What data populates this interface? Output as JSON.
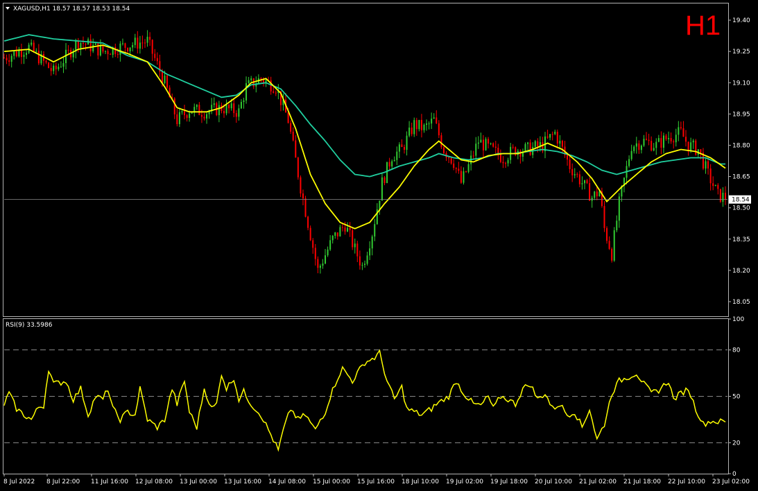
{
  "header": {
    "symbol_line": "XAGUSD,H1  18.57 18.57 18.53 18.54",
    "timeframe": "H1"
  },
  "price_pane": {
    "current_price_label": "18.54",
    "current_price": 18.54
  },
  "rsi_pane": {
    "label": "RSI(9) 33.5986"
  },
  "colors": {
    "background": "#000000",
    "bull": "#32cd32",
    "bear": "#ff0000",
    "fast_ma": "#ffff00",
    "slow_ma": "#20d0a0",
    "rsi": "#ffff00",
    "timeframe_text": "#ff0000"
  },
  "chart_data": [
    {
      "type": "candlestick",
      "symbol": "XAGUSD",
      "timeframe": "H1",
      "ylim": [
        17.98,
        19.48
      ],
      "y_ticks": [
        19.4,
        19.25,
        19.1,
        18.95,
        18.8,
        18.65,
        18.5,
        18.35,
        18.2,
        18.05
      ],
      "x_tick_labels": [
        "8 Jul 2022",
        "8 Jul 22:00",
        "11 Jul 16:00",
        "12 Jul 08:00",
        "13 Jul 00:00",
        "13 Jul 16:00",
        "14 Jul 08:00",
        "15 Jul 00:00",
        "15 Jul 16:00",
        "18 Jul 10:00",
        "19 Jul 02:00",
        "19 Jul 18:00",
        "20 Jul 10:00",
        "21 Jul 02:00",
        "21 Jul 18:00",
        "22 Jul 10:00",
        "23 Jul 02:00"
      ],
      "close_path": [
        [
          0,
          19.22
        ],
        [
          10,
          19.27
        ],
        [
          20,
          19.15
        ],
        [
          30,
          19.3
        ],
        [
          40,
          19.25
        ],
        [
          50,
          19.28
        ],
        [
          58,
          19.3
        ],
        [
          65,
          19.1
        ],
        [
          70,
          18.92
        ],
        [
          75,
          18.97
        ],
        [
          82,
          18.96
        ],
        [
          88,
          18.98
        ],
        [
          95,
          18.96
        ],
        [
          98,
          19.08
        ],
        [
          104,
          19.12
        ],
        [
          110,
          19.08
        ],
        [
          115,
          18.92
        ],
        [
          120,
          18.6
        ],
        [
          127,
          18.2
        ],
        [
          133,
          18.35
        ],
        [
          138,
          18.42
        ],
        [
          142,
          18.3
        ],
        [
          145,
          18.22
        ],
        [
          149,
          18.38
        ],
        [
          153,
          18.62
        ],
        [
          157,
          18.75
        ],
        [
          161,
          18.78
        ],
        [
          166,
          18.9
        ],
        [
          170,
          18.88
        ],
        [
          174,
          18.92
        ],
        [
          178,
          18.78
        ],
        [
          182,
          18.72
        ],
        [
          185,
          18.62
        ],
        [
          188,
          18.7
        ],
        [
          192,
          18.82
        ],
        [
          197,
          18.78
        ],
        [
          202,
          18.74
        ],
        [
          207,
          18.78
        ],
        [
          212,
          18.78
        ],
        [
          218,
          18.8
        ],
        [
          223,
          18.86
        ],
        [
          229,
          18.7
        ],
        [
          234,
          18.62
        ],
        [
          238,
          18.55
        ],
        [
          241,
          18.58
        ],
        [
          243,
          18.4
        ],
        [
          246,
          18.28
        ],
        [
          249,
          18.52
        ],
        [
          254,
          18.8
        ],
        [
          259,
          18.82
        ],
        [
          264,
          18.8
        ],
        [
          269,
          18.84
        ],
        [
          274,
          18.86
        ],
        [
          277,
          18.8
        ],
        [
          281,
          18.78
        ],
        [
          285,
          18.66
        ],
        [
          289,
          18.56
        ],
        [
          292,
          18.55
        ]
      ],
      "fast_ma": [
        [
          0,
          19.25
        ],
        [
          10,
          19.26
        ],
        [
          20,
          19.2
        ],
        [
          30,
          19.26
        ],
        [
          40,
          19.28
        ],
        [
          50,
          19.24
        ],
        [
          58,
          19.2
        ],
        [
          65,
          19.08
        ],
        [
          70,
          18.98
        ],
        [
          75,
          18.96
        ],
        [
          82,
          18.96
        ],
        [
          88,
          18.98
        ],
        [
          95,
          19.04
        ],
        [
          100,
          19.1
        ],
        [
          106,
          19.12
        ],
        [
          112,
          19.05
        ],
        [
          118,
          18.88
        ],
        [
          124,
          18.66
        ],
        [
          130,
          18.52
        ],
        [
          136,
          18.43
        ],
        [
          142,
          18.4
        ],
        [
          148,
          18.43
        ],
        [
          154,
          18.52
        ],
        [
          160,
          18.6
        ],
        [
          166,
          18.7
        ],
        [
          172,
          18.78
        ],
        [
          176,
          18.82
        ],
        [
          180,
          18.78
        ],
        [
          185,
          18.73
        ],
        [
          190,
          18.72
        ],
        [
          196,
          18.75
        ],
        [
          202,
          18.76
        ],
        [
          208,
          18.76
        ],
        [
          214,
          18.78
        ],
        [
          220,
          18.81
        ],
        [
          226,
          18.78
        ],
        [
          232,
          18.72
        ],
        [
          238,
          18.64
        ],
        [
          244,
          18.53
        ],
        [
          250,
          18.6
        ],
        [
          256,
          18.66
        ],
        [
          262,
          18.72
        ],
        [
          268,
          18.76
        ],
        [
          274,
          18.78
        ],
        [
          280,
          18.77
        ],
        [
          286,
          18.74
        ],
        [
          292,
          18.69
        ]
      ],
      "slow_ma": [
        [
          0,
          19.3
        ],
        [
          10,
          19.33
        ],
        [
          20,
          19.31
        ],
        [
          30,
          19.3
        ],
        [
          40,
          19.29
        ],
        [
          50,
          19.23
        ],
        [
          58,
          19.2
        ],
        [
          66,
          19.14
        ],
        [
          74,
          19.1
        ],
        [
          82,
          19.06
        ],
        [
          88,
          19.03
        ],
        [
          94,
          19.04
        ],
        [
          100,
          19.09
        ],
        [
          106,
          19.1
        ],
        [
          112,
          19.07
        ],
        [
          118,
          18.99
        ],
        [
          124,
          18.9
        ],
        [
          130,
          18.82
        ],
        [
          136,
          18.73
        ],
        [
          142,
          18.66
        ],
        [
          148,
          18.65
        ],
        [
          154,
          18.67
        ],
        [
          160,
          18.7
        ],
        [
          166,
          18.72
        ],
        [
          172,
          18.74
        ],
        [
          176,
          18.76
        ],
        [
          182,
          18.74
        ],
        [
          188,
          18.73
        ],
        [
          194,
          18.74
        ],
        [
          200,
          18.76
        ],
        [
          206,
          18.76
        ],
        [
          212,
          18.77
        ],
        [
          218,
          18.78
        ],
        [
          224,
          18.77
        ],
        [
          230,
          18.75
        ],
        [
          236,
          18.72
        ],
        [
          242,
          18.68
        ],
        [
          248,
          18.66
        ],
        [
          254,
          18.68
        ],
        [
          260,
          18.7
        ],
        [
          266,
          18.72
        ],
        [
          272,
          18.73
        ],
        [
          278,
          18.74
        ],
        [
          284,
          18.74
        ],
        [
          290,
          18.71
        ]
      ]
    },
    {
      "type": "line",
      "name": "RSI(9) 33.5986",
      "ylim": [
        0,
        100
      ],
      "y_ticks": [
        100,
        80,
        50,
        20,
        0
      ],
      "levels": [
        80,
        50,
        20
      ],
      "values": [
        [
          0,
          45
        ],
        [
          2,
          52
        ],
        [
          5,
          42
        ],
        [
          8,
          38
        ],
        [
          11,
          35
        ],
        [
          14,
          43
        ],
        [
          16,
          44
        ],
        [
          18,
          68
        ],
        [
          20,
          58
        ],
        [
          23,
          59
        ],
        [
          25,
          60
        ],
        [
          28,
          48
        ],
        [
          31,
          55
        ],
        [
          34,
          38
        ],
        [
          37,
          50
        ],
        [
          40,
          48
        ],
        [
          42,
          55
        ],
        [
          44,
          42
        ],
        [
          47,
          35
        ],
        [
          50,
          40
        ],
        [
          53,
          38
        ],
        [
          55,
          55
        ],
        [
          58,
          35
        ],
        [
          62,
          30
        ],
        [
          65,
          35
        ],
        [
          68,
          55
        ],
        [
          70,
          45
        ],
        [
          73,
          60
        ],
        [
          75,
          40
        ],
        [
          78,
          30
        ],
        [
          81,
          55
        ],
        [
          84,
          42
        ],
        [
          86,
          45
        ],
        [
          88,
          65
        ],
        [
          90,
          55
        ],
        [
          93,
          62
        ],
        [
          95,
          48
        ],
        [
          97,
          53
        ],
        [
          100,
          45
        ],
        [
          104,
          38
        ],
        [
          108,
          25
        ],
        [
          111,
          15
        ],
        [
          113,
          28
        ],
        [
          116,
          42
        ],
        [
          119,
          35
        ],
        [
          122,
          38
        ],
        [
          126,
          28
        ],
        [
          128,
          35
        ],
        [
          130,
          40
        ],
        [
          132,
          50
        ],
        [
          135,
          62
        ],
        [
          137,
          68
        ],
        [
          141,
          60
        ],
        [
          143,
          65
        ],
        [
          146,
          72
        ],
        [
          150,
          75
        ],
        [
          152,
          78
        ],
        [
          155,
          60
        ],
        [
          158,
          48
        ],
        [
          161,
          56
        ],
        [
          163,
          42
        ],
        [
          166,
          40
        ],
        [
          169,
          38
        ],
        [
          173,
          42
        ],
        [
          175,
          45
        ],
        [
          178,
          48
        ],
        [
          180,
          50
        ],
        [
          183,
          60
        ],
        [
          186,
          52
        ],
        [
          190,
          45
        ],
        [
          193,
          44
        ],
        [
          196,
          50
        ],
        [
          198,
          42
        ],
        [
          201,
          50
        ],
        [
          204,
          48
        ],
        [
          207,
          45
        ],
        [
          210,
          55
        ],
        [
          213,
          58
        ],
        [
          216,
          48
        ],
        [
          219,
          52
        ],
        [
          222,
          42
        ],
        [
          225,
          45
        ],
        [
          228,
          38
        ],
        [
          231,
          40
        ],
        [
          234,
          30
        ],
        [
          237,
          42
        ],
        [
          240,
          22
        ],
        [
          243,
          32
        ],
        [
          246,
          52
        ],
        [
          249,
          60
        ],
        [
          252,
          62
        ],
        [
          256,
          65
        ],
        [
          259,
          58
        ],
        [
          262,
          52
        ],
        [
          265,
          54
        ],
        [
          269,
          60
        ],
        [
          271,
          48
        ],
        [
          274,
          52
        ],
        [
          277,
          55
        ],
        [
          280,
          42
        ],
        [
          283,
          32
        ],
        [
          286,
          34
        ],
        [
          289,
          33.6
        ]
      ]
    }
  ]
}
